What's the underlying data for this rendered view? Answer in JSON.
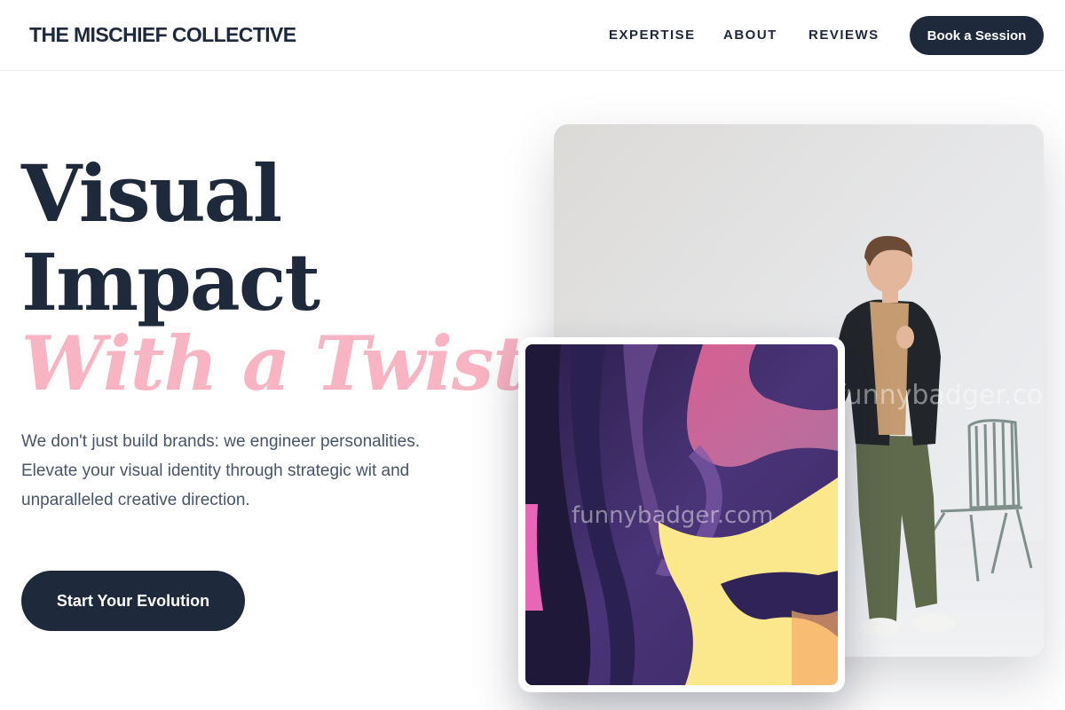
{
  "header": {
    "brand": "THE MISCHIEF COLLECTIVE",
    "nav": [
      {
        "label": "EXPERTISE"
      },
      {
        "label": "ABOUT"
      },
      {
        "label": "REVIEWS"
      }
    ],
    "cta_label": "Book a Session"
  },
  "hero": {
    "headline_line1": "Visual",
    "headline_line2": "Impact",
    "accent_line": "With a Twist.",
    "description": "We don't just build brands: we engineer personalities. Elevate your visual identity through strategic wit and unparalleled creative direction.",
    "cta_label": "Start Your Evolution"
  },
  "images": {
    "photo_watermark": "funnybadger.com",
    "art_watermark": "funnybadger.com"
  },
  "colors": {
    "primary": "#1e293b",
    "accent_pink": "#f9b4c4",
    "body_text": "#475569"
  }
}
